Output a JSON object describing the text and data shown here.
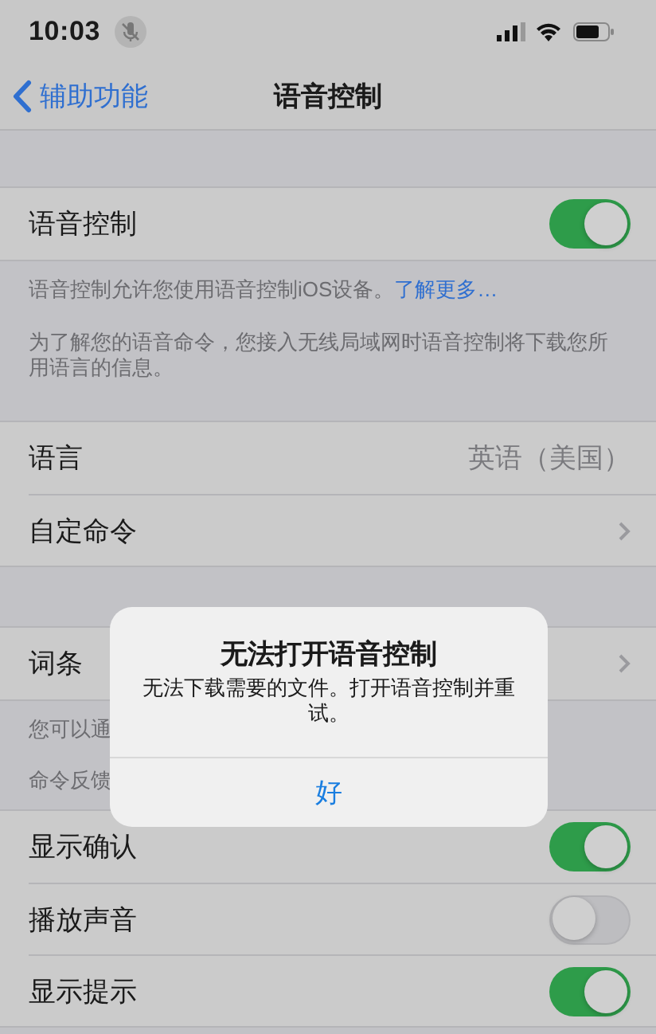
{
  "status_bar": {
    "time": "10:03"
  },
  "nav": {
    "back": "辅助功能",
    "title": "语音控制"
  },
  "sections": [
    {
      "rows": [
        {
          "kind": "toggle",
          "label": "语音控制",
          "on": true
        }
      ],
      "footer": [
        {
          "text": "语音控制允许您使用语音控制iOS设备。",
          "link": "了解更多…"
        },
        {
          "text": "为了解您的语音命令，您接入无线局域网时语音控制将下载您所用语言的信息。"
        }
      ]
    },
    {
      "rows": [
        {
          "kind": "value",
          "label": "语言",
          "value": "英语（美国）"
        },
        {
          "kind": "chevron",
          "label": "自定命令"
        }
      ]
    },
    {
      "rows": [
        {
          "kind": "chevron",
          "label": "词条"
        }
      ],
      "footer": [
        {
          "text": "您可以通"
        }
      ]
    },
    {
      "header": "命令反馈",
      "rows": [
        {
          "kind": "toggle",
          "label": "显示确认",
          "on": true
        },
        {
          "kind": "toggle",
          "label": "播放声音",
          "on": false
        },
        {
          "kind": "toggle",
          "label": "显示提示",
          "on": true
        }
      ]
    }
  ],
  "alert": {
    "title": "无法打开语音控制",
    "message": "无法下载需要的文件。打开语音控制并重试。",
    "button": "好"
  }
}
